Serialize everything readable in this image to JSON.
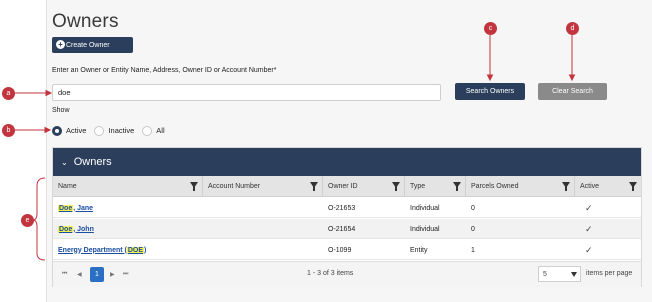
{
  "page": {
    "title": "Owners",
    "create_button": "Create Owner",
    "search_label": "Enter an Owner or Entity Name, Address, Owner ID or Account Number*",
    "search_value": "doe",
    "search_button": "Search Owners",
    "clear_button": "Clear Search",
    "show_label": "Show",
    "filters": [
      "Active",
      "Inactive",
      "All"
    ],
    "selected_filter": "Active"
  },
  "grid": {
    "title": "Owners",
    "columns": [
      "Name",
      "Account Number",
      "Owner ID",
      "Type",
      "Parcels Owned",
      "Active"
    ],
    "rows": [
      {
        "name_hl": "Doe",
        "name_rest": ", Jane",
        "owner_id": "O-21653",
        "type": "Individual",
        "parcels": "0",
        "active": "✓"
      },
      {
        "name_hl": "Doe",
        "name_rest": ", John",
        "owner_id": "O-21654",
        "type": "Individual",
        "parcels": "0",
        "active": "✓"
      },
      {
        "name_pre": "Energy Department (",
        "name_hl": "DOE",
        "name_post": ")",
        "owner_id": "O-1099",
        "type": "Entity",
        "parcels": "1",
        "active": "✓"
      }
    ],
    "pager": {
      "first": "⏮",
      "prev": "◀",
      "page": "1",
      "next": "▶",
      "last": "⏭",
      "info": "1 - 3 of 3 items",
      "page_size": "5",
      "page_size_label": "items per page"
    }
  },
  "callouts": {
    "a": "a",
    "b": "b",
    "c": "c",
    "d": "d",
    "e": "e"
  },
  "colors": {
    "navy": "#2b3f5c",
    "callout": "#c2353f",
    "highlight": "#f5f050",
    "link": "#1a4ea0"
  }
}
